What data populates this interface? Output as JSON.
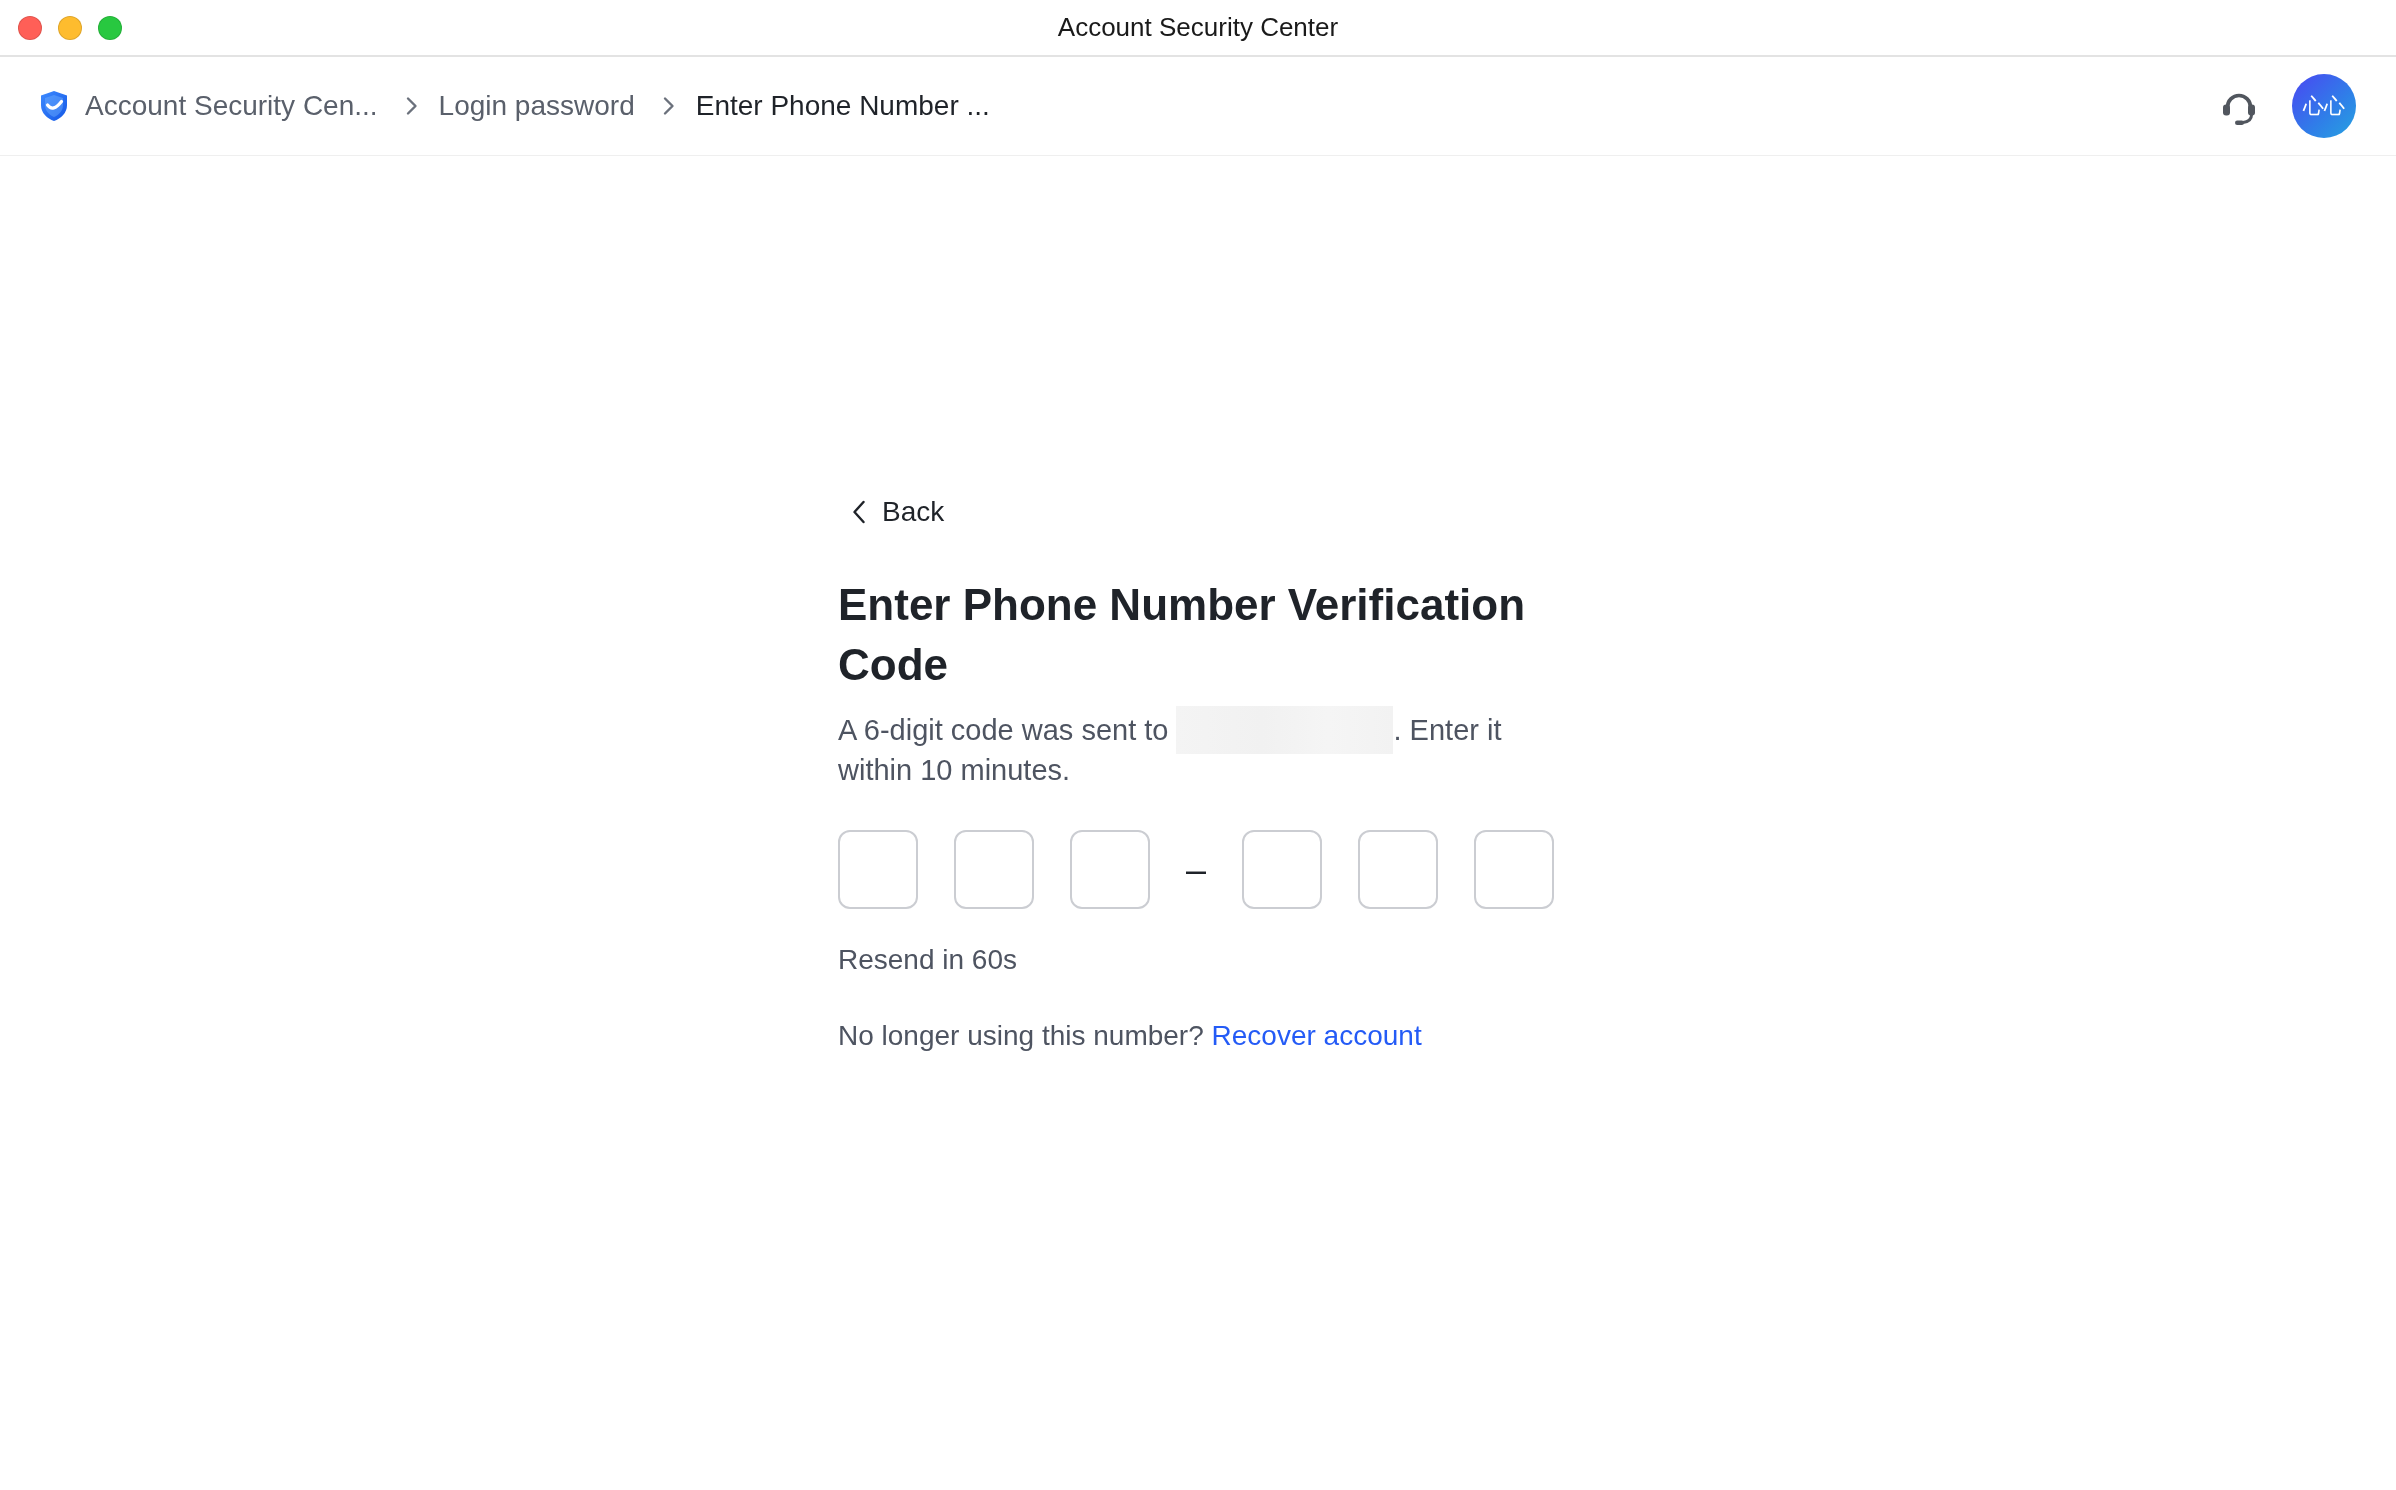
{
  "window": {
    "title": "Account Security Center"
  },
  "breadcrumb": [
    {
      "label": "Account Security Cen...",
      "current": false
    },
    {
      "label": "Login password",
      "current": false
    },
    {
      "label": "Enter Phone Number ...",
      "current": true
    }
  ],
  "avatar": {
    "initials": "心心"
  },
  "back": {
    "label": "Back"
  },
  "heading": "Enter Phone Number Verification Code",
  "description": {
    "line_1_start": "A 6-digit code was sent to",
    "line_1_end": ". Enter it",
    "line_2": "within 10 minutes."
  },
  "code_groups": [
    {
      "boxes": [
        {
          "focused": false
        },
        {
          "focused": false
        },
        {
          "focused": false
        }
      ]
    },
    {
      "boxes": [
        {
          "focused": false
        },
        {
          "focused": false
        },
        {
          "focused": false
        }
      ]
    }
  ],
  "separator": "–",
  "resend": "Resend in 60s",
  "recovery": {
    "prompt": "No longer using this number?",
    "link": "Recover account"
  }
}
